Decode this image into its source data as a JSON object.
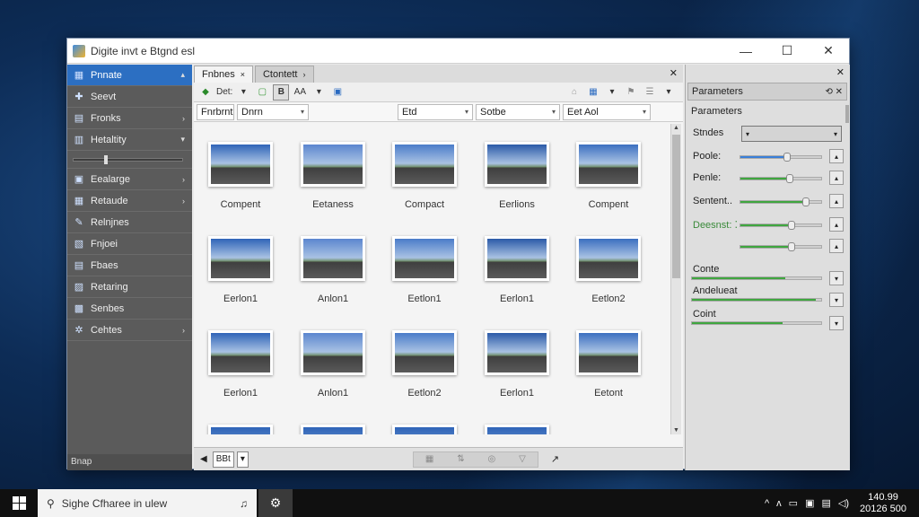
{
  "window": {
    "title": "Digite invt e Btgnd esl",
    "minimize": "—",
    "maximize": "☐",
    "close": "✕"
  },
  "sidebar": {
    "items": [
      {
        "icon": "grid-icon",
        "glyph": "▦",
        "label": "Pnnate",
        "arrow": "▴",
        "active": true
      },
      {
        "icon": "plus-icon",
        "glyph": "✚",
        "label": "Seevt",
        "arrow": ""
      },
      {
        "icon": "frames-icon",
        "glyph": "▤",
        "label": "Fronks",
        "arrow": "›"
      },
      {
        "icon": "filter-icon",
        "glyph": "▥",
        "label": "Hetaltity",
        "arrow": "▾"
      },
      {
        "icon": "exchange-icon",
        "glyph": "▣",
        "label": "Eealarge",
        "arrow": "›"
      },
      {
        "icon": "resize-icon",
        "glyph": "▦",
        "label": "Retaude",
        "arrow": "›"
      },
      {
        "icon": "wand-icon",
        "glyph": "✎",
        "label": "Relnjnes",
        "arrow": ""
      },
      {
        "icon": "flag-icon",
        "glyph": "▧",
        "label": "Fnjoei",
        "arrow": ""
      },
      {
        "icon": "folder-icon",
        "glyph": "▤",
        "label": "Fbaes",
        "arrow": ""
      },
      {
        "icon": "rating-icon",
        "glyph": "▨",
        "label": "Retaring",
        "arrow": ""
      },
      {
        "icon": "sources-icon",
        "glyph": "▩",
        "label": "Senbes",
        "arrow": ""
      },
      {
        "icon": "settings-icon",
        "glyph": "✲",
        "label": "Cehtes",
        "arrow": "›"
      }
    ],
    "slider_value": 0.3,
    "footer": "Bnap"
  },
  "center": {
    "tabs": [
      {
        "label": "Fnbnes",
        "close": "×",
        "active": true
      },
      {
        "label": "Ctontett",
        "close": "›",
        "active": false
      }
    ],
    "tabs_close": "✕",
    "toolbar": {
      "dest_label": "Det:",
      "b_label": "B",
      "aa_label": "AA"
    },
    "filters": [
      {
        "label": "Fnrbrnt",
        "dropdown": false
      },
      {
        "label": "Dnrn",
        "dropdown": true
      },
      {
        "label": "Etd",
        "dropdown": true
      },
      {
        "label": "Sotbe",
        "dropdown": true
      },
      {
        "label": "Eet Aol",
        "dropdown": true
      }
    ],
    "thumbnails": [
      {
        "caption": "Compent"
      },
      {
        "caption": "Eetaness"
      },
      {
        "caption": "Compact"
      },
      {
        "caption": "Eerlions"
      },
      {
        "caption": "Compent"
      },
      {
        "caption": "Eerlon1"
      },
      {
        "caption": "Anlon1"
      },
      {
        "caption": "Eetlon1"
      },
      {
        "caption": "Eerlon1"
      },
      {
        "caption": "Eetlon2"
      },
      {
        "caption": "Eerlon1"
      },
      {
        "caption": "Anlon1"
      },
      {
        "caption": "Eetlon2"
      },
      {
        "caption": "Eerlon1"
      },
      {
        "caption": "Eetont"
      }
    ],
    "bottom": {
      "page_label": "B",
      "page_suffix": "Bt",
      "end_symbol": "↗"
    }
  },
  "params": {
    "header": "Parameters",
    "header_buttons": "⟲ ✕",
    "subtitle": "Parameters",
    "close": "✕",
    "rows": [
      {
        "label": "Stndes",
        "type": "select",
        "value": "▾"
      },
      {
        "label": "Poole:",
        "type": "slider",
        "level": 0.55,
        "color": "#3a7fd8"
      },
      {
        "label": "Penle:",
        "type": "slider",
        "level": 0.58,
        "color": "#3fa63f"
      },
      {
        "label": "Sentent..",
        "type": "slider",
        "level": 0.78,
        "color": "#3fa63f"
      },
      {
        "label": "Deesnst: ⁚",
        "type": "slider",
        "level": 0.6,
        "color": "#3fa63f",
        "green": true
      },
      {
        "label": "",
        "type": "slider",
        "level": 0.6,
        "color": "#3fa63f"
      },
      {
        "label": "Conte",
        "type": "bar",
        "level": 0.72,
        "color": "#3fa63f"
      },
      {
        "label": "Andelueat",
        "type": "bar",
        "level": 0.96,
        "color": "#3fa63f"
      },
      {
        "label": "Coint",
        "type": "bar",
        "level": 0.7,
        "color": "#3fa63f"
      }
    ]
  },
  "taskbar": {
    "search_placeholder": "Sighe Cfharee in ulew",
    "tray_icons": [
      "^",
      "ᴧ",
      "▭",
      "▣",
      "▤",
      "◁)"
    ],
    "time": "140.99",
    "date": "20126 500"
  }
}
